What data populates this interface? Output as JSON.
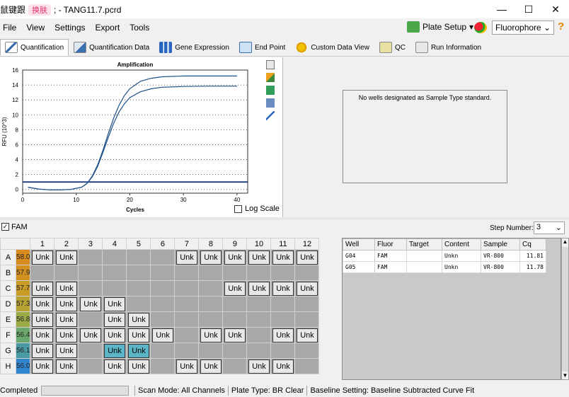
{
  "window": {
    "title_prefix": "鼠键跟",
    "title_badge": "换肤",
    "title": "; - TANG11.7.pcrd",
    "min": "—",
    "max": "☐",
    "close": "✕"
  },
  "menu": [
    {
      "label": "File"
    },
    {
      "label": "View"
    },
    {
      "label": "Settings"
    },
    {
      "label": "Export"
    },
    {
      "label": "Tools"
    }
  ],
  "toolbar": {
    "plate_setup": "Plate Setup",
    "fluorophore": "Fluorophore",
    "help": "?"
  },
  "tabs": [
    {
      "label": "Quantification",
      "active": true,
      "icon": "amplification-icon"
    },
    {
      "label": "Quantification Data",
      "icon": "data-icon"
    },
    {
      "label": "Gene Expression",
      "icon": "bar-chart-icon"
    },
    {
      "label": "End Point",
      "icon": "endpoint-icon"
    },
    {
      "label": "Custom Data View",
      "icon": "gear-icon"
    },
    {
      "label": "QC",
      "icon": "qc-icon"
    },
    {
      "label": "Run Information",
      "icon": "info-icon"
    }
  ],
  "chart_data": {
    "type": "line",
    "title": "Amplification",
    "xlabel": "Cycles",
    "ylabel": "RFU (10^3)",
    "xlim": [
      0,
      42
    ],
    "ylim": [
      -0.5,
      16
    ],
    "xticks": [
      0,
      10,
      20,
      30,
      40
    ],
    "yticks": [
      0,
      2,
      4,
      6,
      8,
      10,
      12,
      14,
      16
    ],
    "threshold": 1.0,
    "series": [
      {
        "values": [
          [
            1,
            0.3
          ],
          [
            3,
            0.05
          ],
          [
            5,
            -0.05
          ],
          [
            7,
            -0.05
          ],
          [
            9,
            0.0
          ],
          [
            11,
            0.3
          ],
          [
            12,
            0.8
          ],
          [
            13,
            1.8
          ],
          [
            14,
            3.3
          ],
          [
            15,
            5.3
          ],
          [
            16,
            7.5
          ],
          [
            17,
            9.6
          ],
          [
            18,
            11.3
          ],
          [
            19,
            12.6
          ],
          [
            20,
            13.5
          ],
          [
            22,
            14.5
          ],
          [
            24,
            14.9
          ],
          [
            26,
            15.1
          ],
          [
            30,
            15.2
          ],
          [
            35,
            15.2
          ],
          [
            40,
            15.2
          ]
        ]
      },
      {
        "values": [
          [
            1,
            0.3
          ],
          [
            3,
            0.05
          ],
          [
            5,
            -0.05
          ],
          [
            7,
            -0.05
          ],
          [
            9,
            0.0
          ],
          [
            11,
            0.3
          ],
          [
            12,
            0.8
          ],
          [
            13,
            1.7
          ],
          [
            14,
            3.1
          ],
          [
            15,
            5.0
          ],
          [
            16,
            7.0
          ],
          [
            17,
            8.9
          ],
          [
            18,
            10.4
          ],
          [
            19,
            11.5
          ],
          [
            20,
            12.3
          ],
          [
            22,
            13.1
          ],
          [
            24,
            13.5
          ],
          [
            26,
            13.7
          ],
          [
            30,
            13.8
          ],
          [
            35,
            13.85
          ],
          [
            40,
            13.85
          ]
        ]
      }
    ],
    "log_scale_label": "Log Scale"
  },
  "right_pane": {
    "message": "No wells designated as Sample Type standard."
  },
  "fam": {
    "label": "FAM",
    "step_label": "Step Number:",
    "step_value": "3"
  },
  "plate": {
    "columns": [
      "1",
      "2",
      "3",
      "4",
      "5",
      "6",
      "7",
      "8",
      "9",
      "10",
      "11",
      "12"
    ],
    "rows": [
      {
        "label": "A",
        "temp": "58.0",
        "color": "#d98b1e",
        "cells": [
          "Unk",
          "Unk",
          "",
          "",
          "",
          "",
          "Unk",
          "Unk",
          "Unk",
          "Unk",
          "Unk",
          "Unk"
        ]
      },
      {
        "label": "B",
        "temp": "57.9",
        "color": "#d2911f",
        "cells": [
          "",
          "",
          "",
          "",
          "",
          "",
          "",
          "",
          "",
          "",
          "",
          ""
        ]
      },
      {
        "label": "C",
        "temp": "57.7",
        "color": "#c99c28",
        "cells": [
          "Unk",
          "Unk",
          "",
          "",
          "",
          "",
          "",
          "",
          "Unk",
          "Unk",
          "Unk",
          "Unk"
        ]
      },
      {
        "label": "D",
        "temp": "57.3",
        "color": "#b7a232",
        "cells": [
          "Unk",
          "Unk",
          "Unk",
          "Unk",
          "",
          "",
          "",
          "",
          "",
          "",
          "",
          ""
        ]
      },
      {
        "label": "E",
        "temp": "56.8",
        "color": "#9aab45",
        "cells": [
          "Unk",
          "Unk",
          "",
          "Unk",
          "Unk",
          "",
          "",
          "",
          "",
          "",
          "",
          ""
        ]
      },
      {
        "label": "F",
        "temp": "56.4",
        "color": "#6ba86e",
        "cells": [
          "Unk",
          "Unk",
          "Unk",
          "Unk",
          "Unk",
          "Unk",
          "",
          "Unk",
          "Unk",
          "",
          "Unk",
          "Unk"
        ]
      },
      {
        "label": "G",
        "temp": "56.1",
        "color": "#4a9aa3",
        "cells": [
          "Unk",
          "Unk",
          "",
          "Unk*",
          "Unk*",
          "",
          "",
          "",
          "",
          "",
          "",
          ""
        ]
      },
      {
        "label": "H",
        "temp": "56.0",
        "color": "#2f86cf",
        "cells": [
          "Unk",
          "Unk",
          "",
          "Unk",
          "Unk",
          "",
          "Unk",
          "Unk",
          "",
          "Unk",
          "Unk",
          ""
        ]
      }
    ]
  },
  "wells_table": {
    "headers": [
      "Well",
      "Fluor",
      "Target",
      "Content",
      "Sample",
      "Cq"
    ],
    "rows": [
      {
        "well": "G04",
        "fluor": "FAM",
        "target": "",
        "content": "Unkn",
        "sample": "VR-800",
        "cq": "11.81"
      },
      {
        "well": "G05",
        "fluor": "FAM",
        "target": "",
        "content": "Unkn",
        "sample": "VR-800",
        "cq": "11.78"
      }
    ]
  },
  "status": {
    "state": "Completed",
    "scan_mode": "Scan Mode: All Channels",
    "plate_type": "Plate Type: BR Clear",
    "baseline": "Baseline Setting: Baseline Subtracted Curve Fit"
  }
}
